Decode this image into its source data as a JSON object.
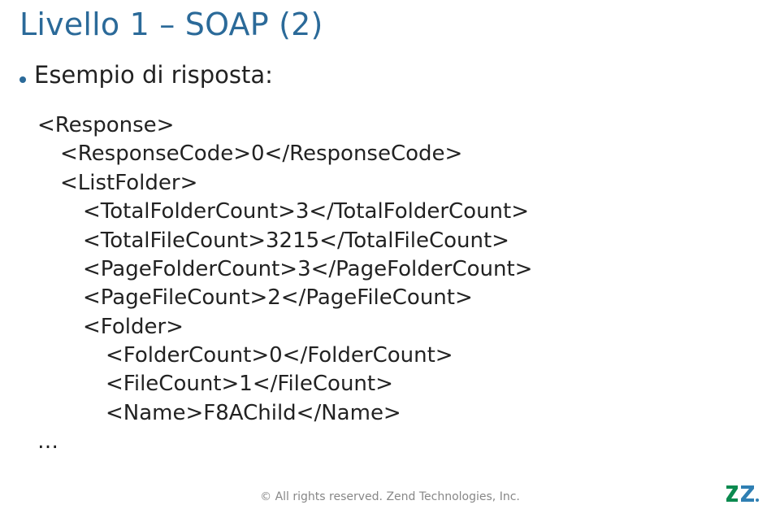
{
  "title": "Livello 1 – SOAP (2)",
  "bullet_label": "Esempio di risposta:",
  "code": {
    "l1": "<Response>",
    "l2": "<ResponseCode>0</ResponseCode>",
    "l3": "<ListFolder>",
    "l4": "<TotalFolderCount>3</TotalFolderCount>",
    "l5": "<TotalFileCount>3215</TotalFileCount>",
    "l6": "<PageFolderCount>3</PageFolderCount>",
    "l7": "<PageFileCount>2</PageFileCount>",
    "l8": "<Folder>",
    "l9": "<FolderCount>0</FolderCount>",
    "l10": "<FileCount>1</FileCount>",
    "l11": "<Name>F8AChild</Name>",
    "l12": "…"
  },
  "footer_text": "© All rights reserved. Zend Technologies, Inc."
}
